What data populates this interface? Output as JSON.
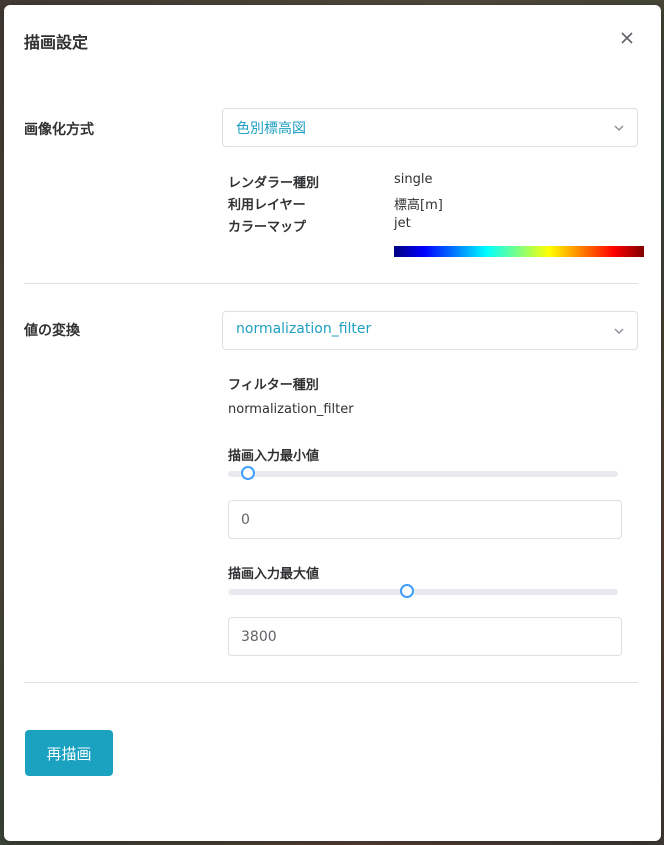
{
  "dialog": {
    "title": "描画設定"
  },
  "imaging": {
    "label": "画像化方式",
    "selected": "色別標高図",
    "info": [
      {
        "key": "レンダラー種別",
        "value": "single"
      },
      {
        "key": "利用レイヤー",
        "value": "標高[m]"
      },
      {
        "key": "カラーマップ",
        "value": "jet"
      }
    ]
  },
  "transform": {
    "label": "値の変換",
    "selected": "normalization_filter",
    "filter_type_label": "フィルター種別",
    "filter_type_value": "normalization_filter",
    "min": {
      "label": "描画入力最小値",
      "value": "0",
      "slider_fraction": 0.05
    },
    "max": {
      "label": "描画入力最大値",
      "value": "3800",
      "slider_fraction": 0.46
    }
  },
  "actions": {
    "redraw_label": "再描画"
  },
  "colors": {
    "accent": "#1aa2c0",
    "slider_border": "#409eff"
  },
  "icons": {
    "close": "close-icon",
    "dropdown": "chevron-down-icon"
  }
}
